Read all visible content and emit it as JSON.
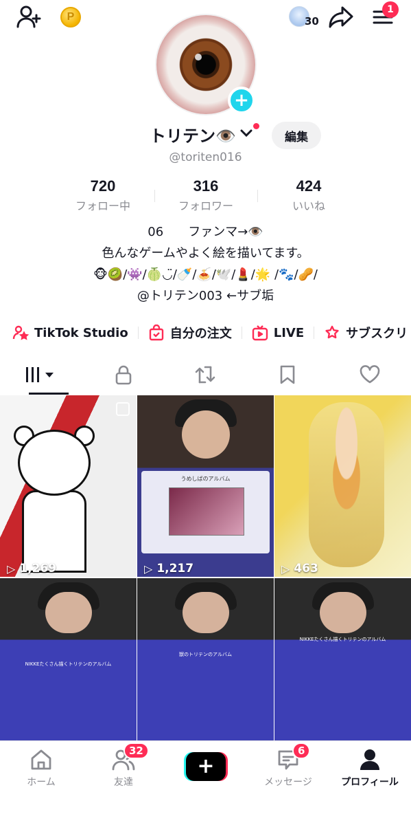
{
  "header": {
    "add_friend_icon": "person-plus-icon",
    "coin_label": "P",
    "mini_avatar_count": "30",
    "share_icon": "share-arrow-icon",
    "menu_icon": "hamburger-menu-icon",
    "menu_badge": "1"
  },
  "profile": {
    "avatar_icon": "eyeball-avatar",
    "name": "トリテン👁️",
    "handle": "@toriten016",
    "edit_label": "編集"
  },
  "stats": [
    {
      "value": "720",
      "label": "フォロー中"
    },
    {
      "value": "316",
      "label": "フォロワー"
    },
    {
      "value": "424",
      "label": "いいね"
    }
  ],
  "bio": {
    "line1": "06　　ファンマ→👁️",
    "line2": "色んなゲームやよく絵を描いてます。",
    "line3": "🐵🥝/👾/🍈◡̈/🍼/🍝/🕊️/💄/🌟 /🐾/🥜/",
    "line4": "@トリテン003 ←サブ垢"
  },
  "shortcuts": [
    {
      "label": "TikTok Studio",
      "icon": "person-star-icon"
    },
    {
      "label": "自分の注文",
      "icon": "shopping-bag-check-icon"
    },
    {
      "label": "LIVE",
      "icon": "live-tv-icon"
    },
    {
      "label": "サブスクリ",
      "icon": "subscription-star-icon"
    }
  ],
  "tabs": [
    {
      "name": "videos-grid",
      "icon": "grid-bars-icon",
      "active": true
    },
    {
      "name": "private",
      "icon": "lock-icon"
    },
    {
      "name": "reposts",
      "icon": "repost-icon"
    },
    {
      "name": "favorites",
      "icon": "bookmark-icon"
    },
    {
      "name": "liked",
      "icon": "heart-icon"
    }
  ],
  "videos": [
    {
      "views": "1,269"
    },
    {
      "views": "1,217",
      "panel_title": "うめしばのアルバム"
    },
    {
      "views": "463"
    },
    {
      "views": "",
      "panel_title": "NIKKEたくさん描くトリテンのアルバム"
    },
    {
      "views": "",
      "panel_title": "獣のトリテンのアルバム"
    },
    {
      "views": "",
      "panel_title": "NIKKEたくさん描くトリテンのアルバム"
    }
  ],
  "bottom_nav": [
    {
      "label": "ホーム",
      "icon": "home-icon"
    },
    {
      "label": "友達",
      "icon": "friends-icon",
      "badge": "32"
    },
    {
      "label": "",
      "icon": "create-plus-icon"
    },
    {
      "label": "メッセージ",
      "icon": "inbox-message-icon",
      "badge": "6"
    },
    {
      "label": "プロフィール",
      "icon": "profile-person-icon",
      "active": true
    }
  ],
  "colors": {
    "accent": "#fe2c55",
    "cyan": "#25f4ee",
    "text": "#161823",
    "muted": "#8a8b91"
  }
}
